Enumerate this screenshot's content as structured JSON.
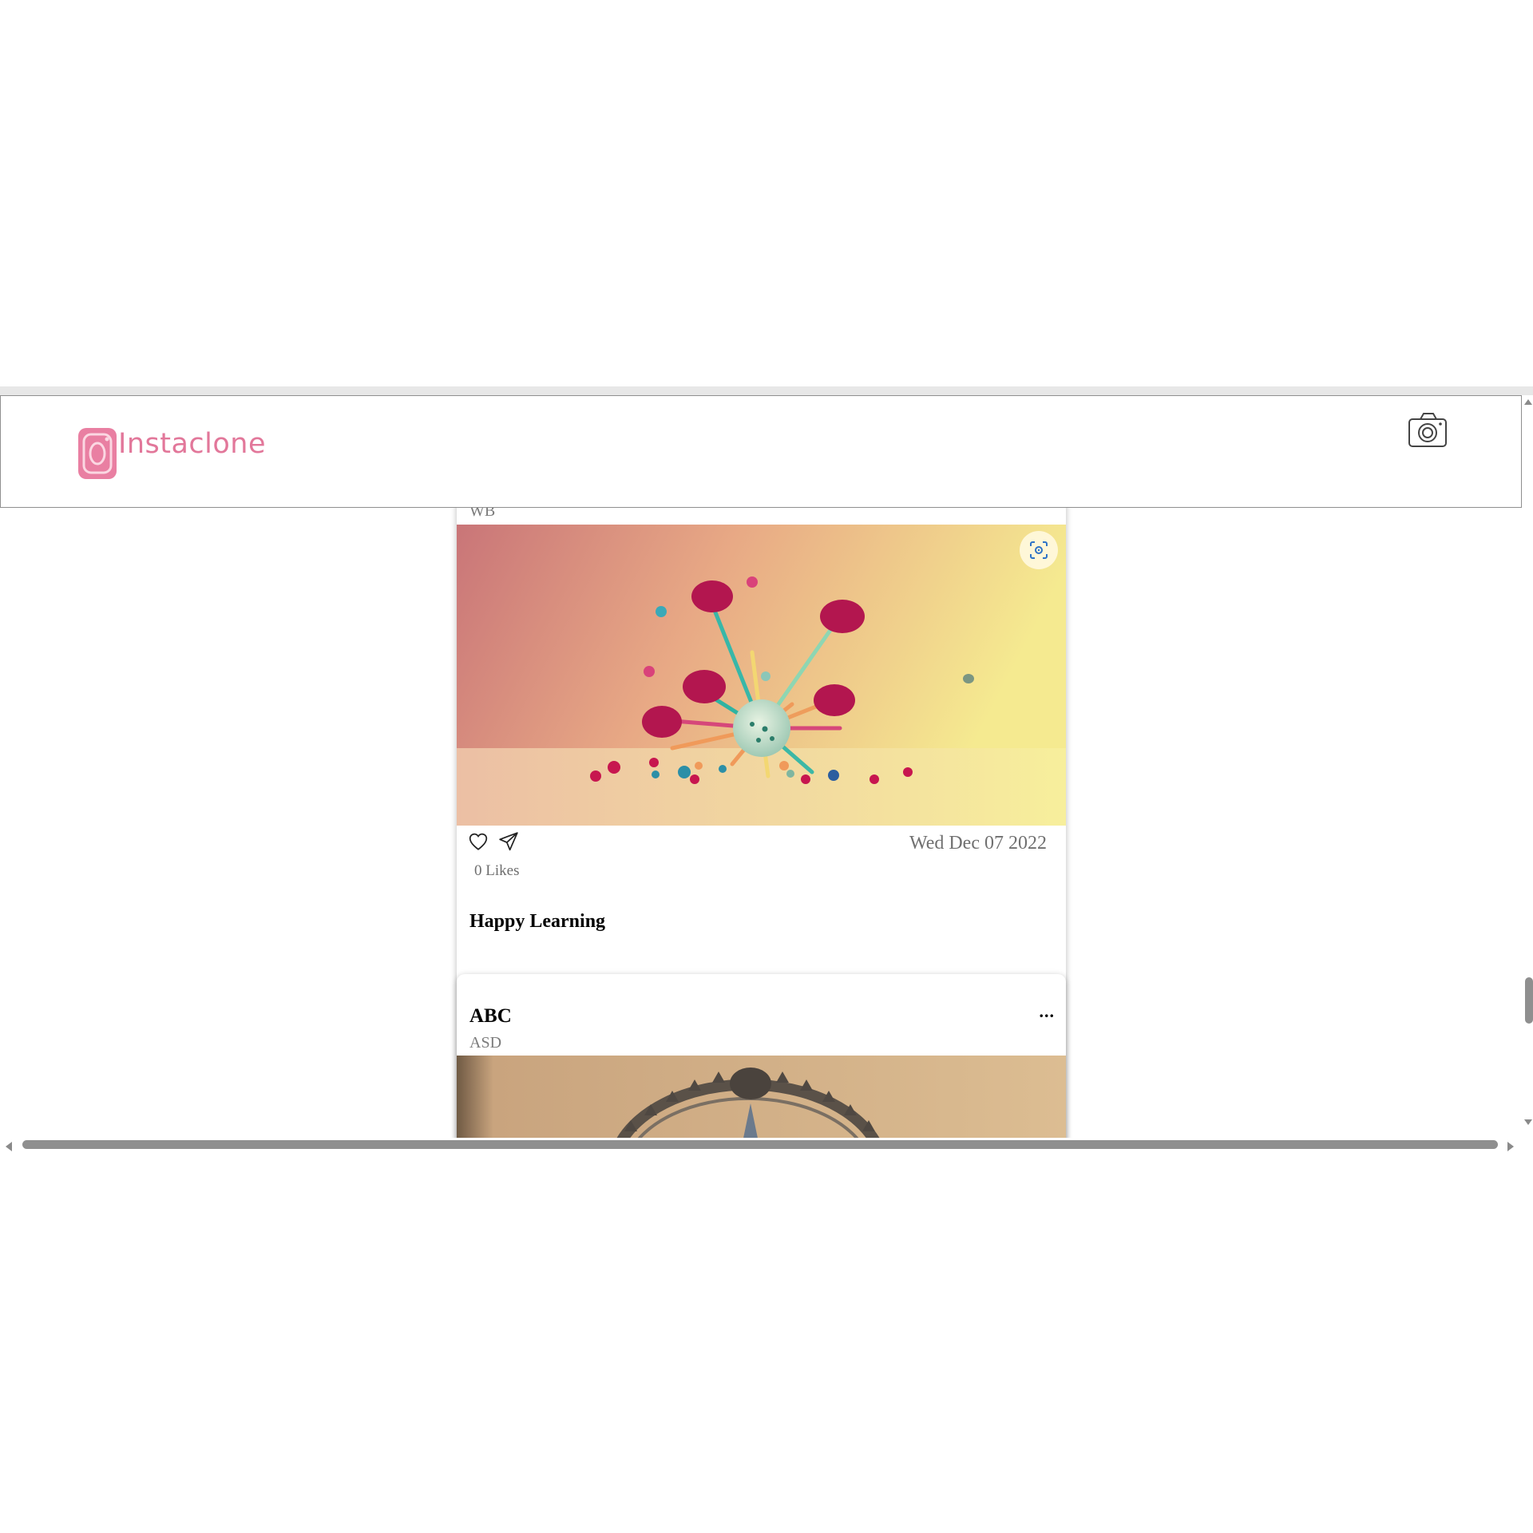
{
  "app": {
    "name": "Instaclone",
    "brand_color": "#e2779a"
  },
  "header": {
    "logo_icon": "instagram-logo-icon",
    "camera_icon": "camera-icon"
  },
  "posts": [
    {
      "location": "WB",
      "date": "Wed Dec 07 2022",
      "likes": "0 Likes",
      "caption": "Happy Learning",
      "image_description_colors": [
        "#d0787a",
        "#f4e88f"
      ],
      "icons": [
        "lens-icon",
        "heart-icon",
        "send-icon"
      ]
    },
    {
      "username": "ABC",
      "more": "...",
      "location": "ASD",
      "image_colors": [
        "#c9a27b",
        "#dcbc90"
      ]
    }
  ]
}
